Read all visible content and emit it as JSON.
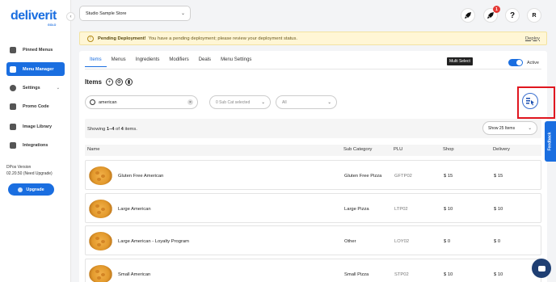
{
  "app": {
    "logo": "deliverit",
    "logo_sub": "GOLO"
  },
  "sidebar": {
    "items": [
      {
        "label": "Pinned Menus",
        "icon": "pin-icon"
      },
      {
        "label": "Menu Manager",
        "icon": "menu-icon",
        "active": true
      },
      {
        "label": "Settings",
        "icon": "gear-icon"
      },
      {
        "label": "Promo Code",
        "icon": "promo-icon"
      },
      {
        "label": "Image Library",
        "icon": "image-icon"
      },
      {
        "label": "Integrations",
        "icon": "integrations-icon"
      }
    ],
    "version_label": "DPos Version",
    "version_value": "02.20.50 (Need Upgrade)",
    "upgrade_label": "Upgrade"
  },
  "header": {
    "store_select": "Studio Sample Store",
    "notification_count": "1",
    "help_label": "?",
    "avatar_initial": "R"
  },
  "alert": {
    "title": "Pending Deployment!",
    "message": "You have a pending deployment; please review your deployment status.",
    "action": "Deploy"
  },
  "tabs": [
    "Items",
    "Menus",
    "Ingredients",
    "Modifiers",
    "Deals",
    "Menu Settings"
  ],
  "active_toggle_label": "Active",
  "items_section": {
    "title": "Items",
    "search_value": "american",
    "subcat_placeholder": "0 Sub Cat selected",
    "filter_value": "All",
    "multi_select_tooltip": "Multi Select",
    "showing_prefix": "Showing ",
    "showing_range": "1–4",
    "showing_of": " of ",
    "showing_total": "4",
    "showing_suffix": " items.",
    "page_size": "Show 25 Items"
  },
  "table": {
    "columns": [
      "Name",
      "Sub Category",
      "PLU",
      "Shop",
      "Delivery"
    ],
    "rows": [
      {
        "name": "Gluten Free American",
        "sub_category": "Gluten Free Pizza",
        "plu": "GFTP02",
        "shop": "$ 15",
        "delivery": "$ 15"
      },
      {
        "name": "Large American",
        "sub_category": "Large Pizza",
        "plu": "LTP02",
        "shop": "$ 10",
        "delivery": "$ 10"
      },
      {
        "name": "Large American - Loyalty Program",
        "sub_category": "Other",
        "plu": "LOY02",
        "shop": "$ 0",
        "delivery": "$ 0"
      },
      {
        "name": "Small American",
        "sub_category": "Small Pizza",
        "plu": "STP02",
        "shop": "$ 10",
        "delivery": "$ 10"
      }
    ]
  },
  "feedback_label": "Feedback",
  "colors": {
    "accent": "#1a6ee0",
    "alert_bg": "#fff6d5",
    "highlight_border": "#e0161f"
  }
}
